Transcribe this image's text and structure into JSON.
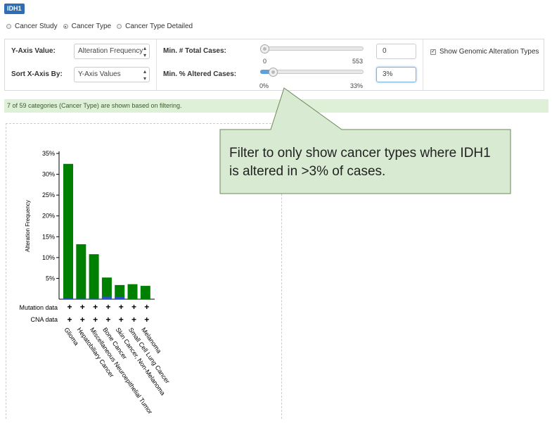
{
  "gene_badge": "IDH1",
  "grouping": {
    "options": [
      "Cancer Study",
      "Cancer Type",
      "Cancer Type Detailed"
    ],
    "selected": "Cancer Type"
  },
  "controls": {
    "y_axis_label": "Y-Axis Value:",
    "y_axis_value": "Alteration Frequency",
    "sort_label": "Sort X-Axis By:",
    "sort_value": "Y-Axis Values",
    "min_total_label": "Min. # Total Cases:",
    "min_total_min": "0",
    "min_total_max": "553",
    "min_total_input": "0",
    "min_total_slider_fraction": 0,
    "min_pct_label": "Min. % Altered Cases:",
    "min_pct_min": "0%",
    "min_pct_max": "33%",
    "min_pct_input": "3%",
    "min_pct_slider_fraction": 0.09,
    "show_types_label": "Show Genomic Alteration Types",
    "show_types_checked": true
  },
  "filter_message": "7 of 59 categories (Cancer Type) are shown based on filtering.",
  "callout": "Filter to only show cancer types where IDH1 is altered in >3% of cases.",
  "colors": {
    "mutation": "#008000",
    "cna": "#2a52be",
    "callout_fill": "#d9ead3",
    "callout_border": "#6a8a55"
  },
  "chart_data": {
    "type": "bar",
    "ylabel": "Alteration Frequency",
    "ylim": [
      0,
      35
    ],
    "yticks": [
      "5%",
      "10%",
      "15%",
      "20%",
      "25%",
      "30%",
      "35%"
    ],
    "ytick_values": [
      5,
      10,
      15,
      20,
      25,
      30,
      35
    ],
    "categories": [
      "Glioma",
      "Hepatobiliary Cancer",
      "Miscellaneous Neuroepithelial Tumor",
      "Bone Cancer",
      "Skin Cancer, Non-Melanoma",
      "Small Cell Lung Cancer",
      "Melanoma"
    ],
    "series": [
      {
        "key": "mutation",
        "values": [
          32.5,
          13.2,
          10.8,
          5.2,
          3.4,
          3.6,
          3.2
        ]
      },
      {
        "key": "cna",
        "values": [
          0.2,
          0.1,
          0.1,
          0.7,
          0.6,
          0,
          0
        ]
      }
    ],
    "track_labels": [
      "Mutation data",
      "CNA data"
    ],
    "track_marker": "+",
    "grid": false
  }
}
